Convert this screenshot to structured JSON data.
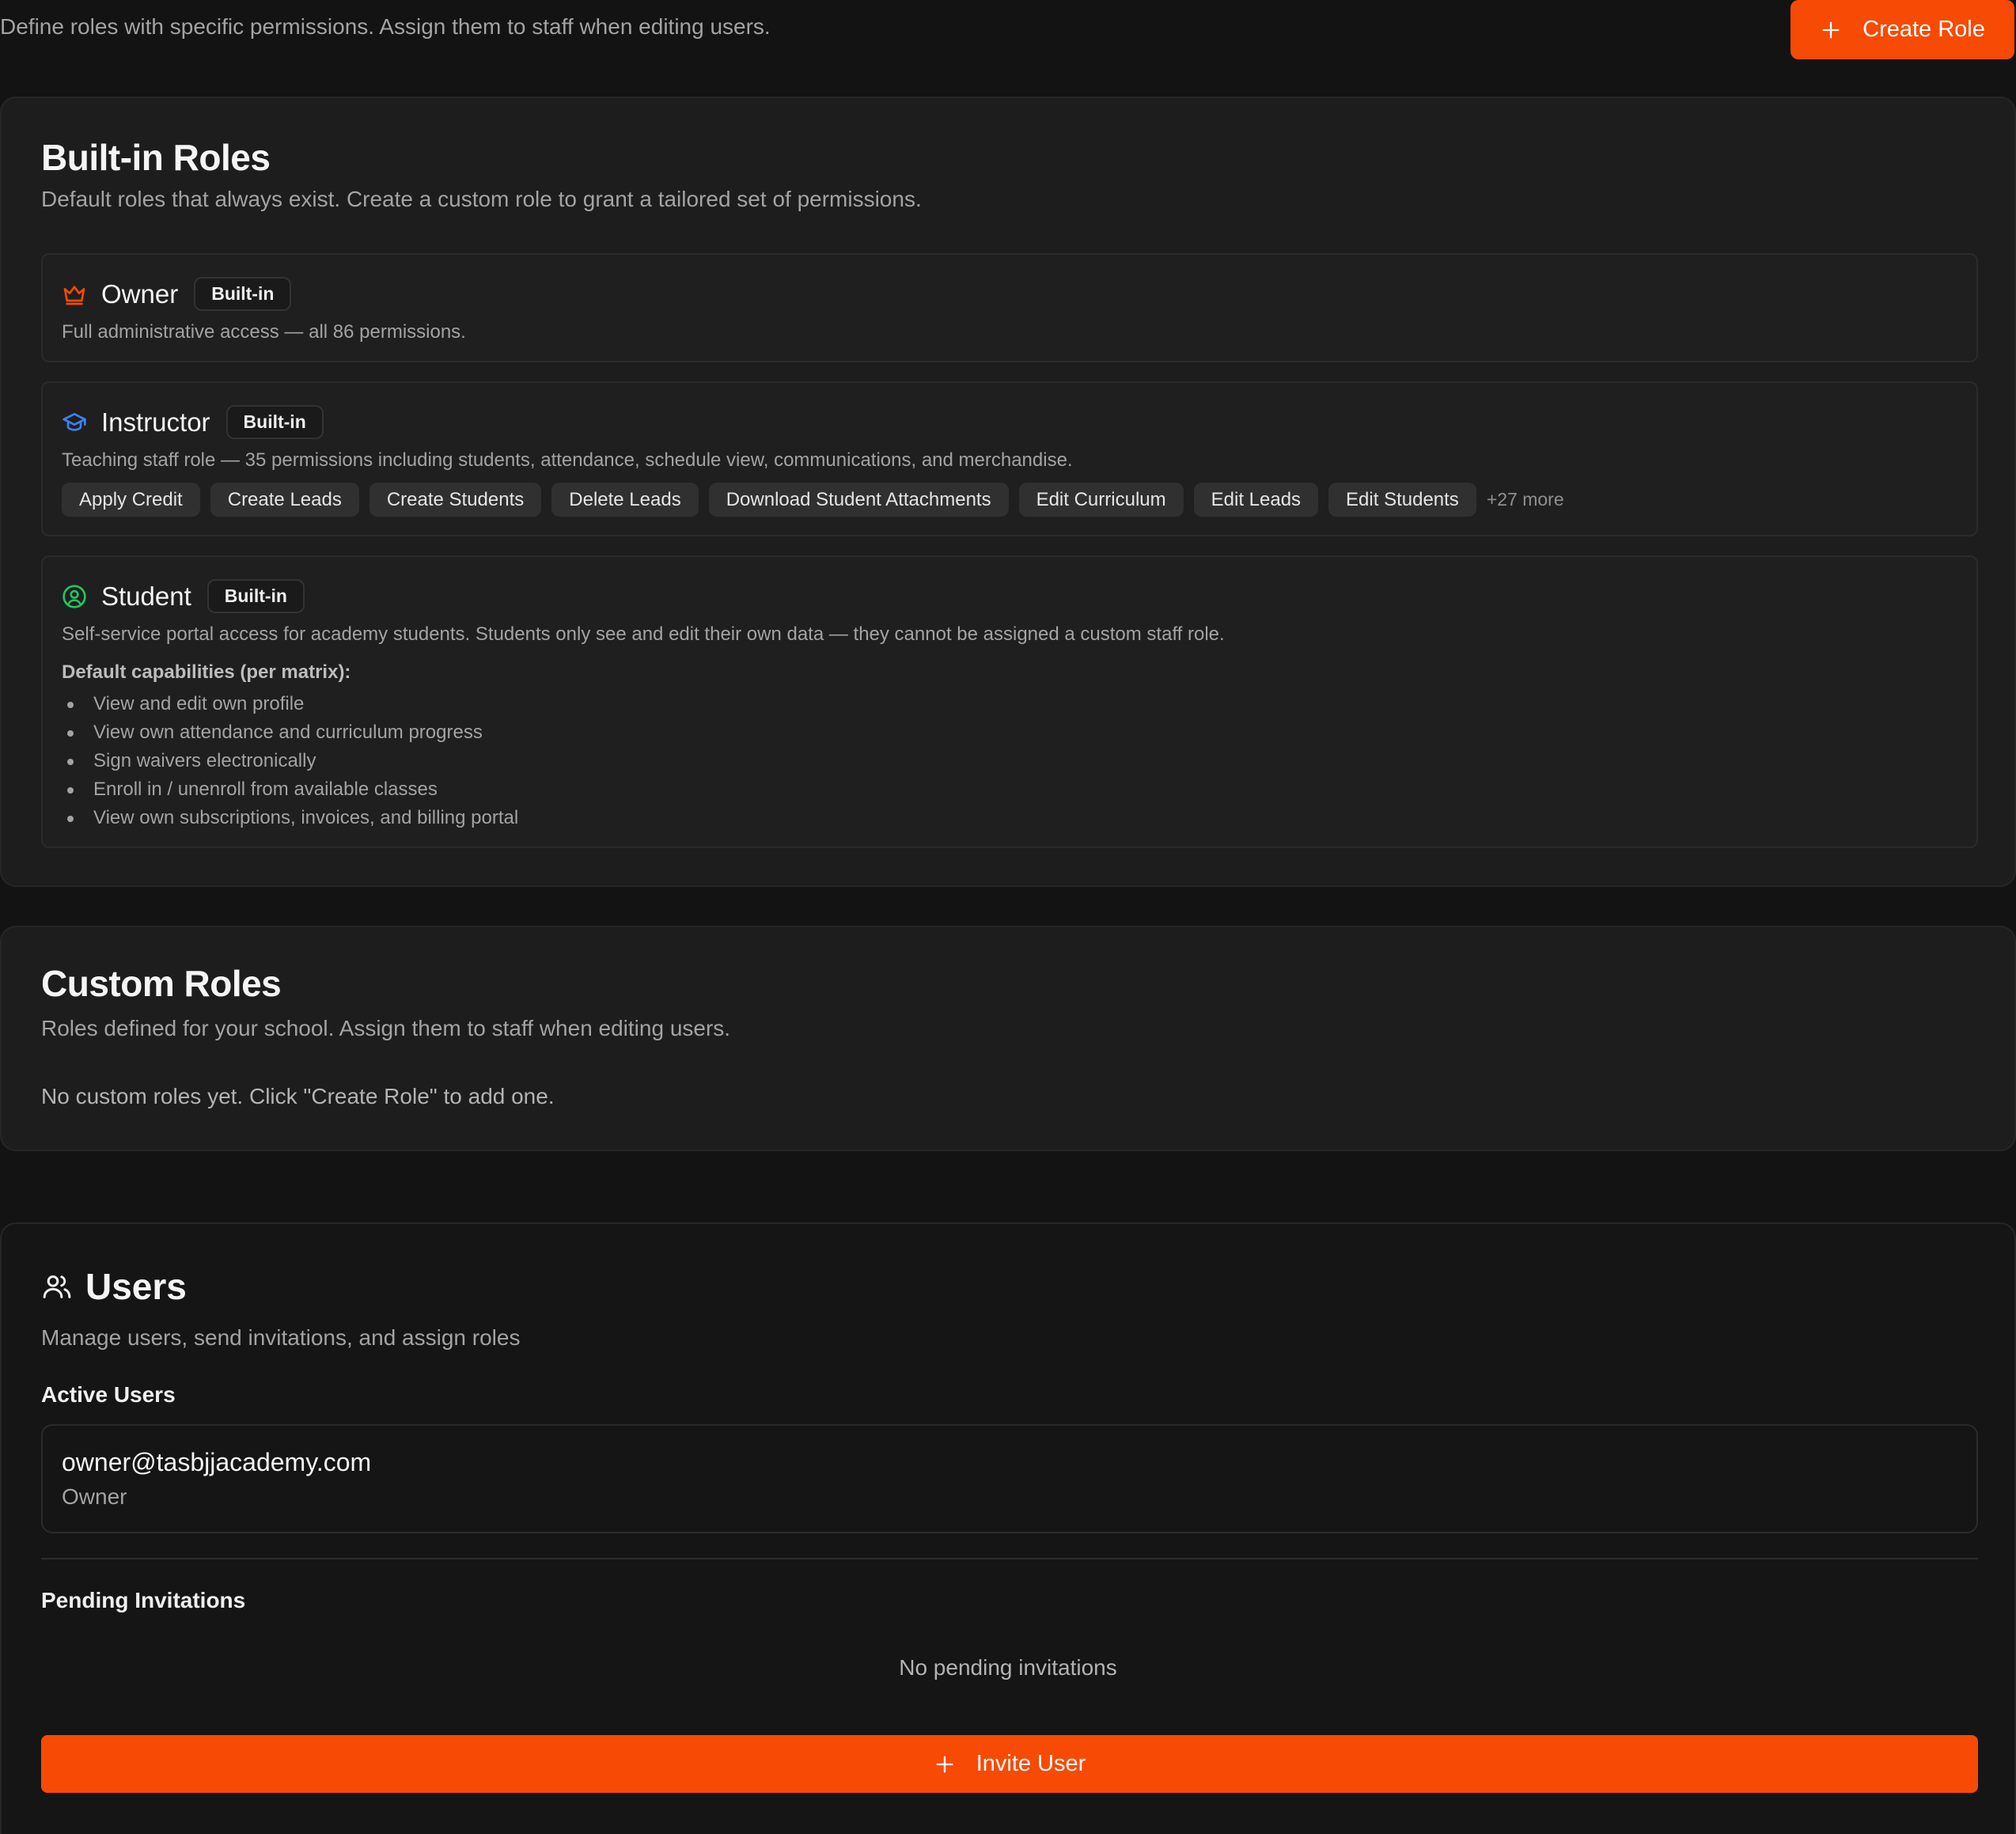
{
  "header": {
    "description": "Define roles with specific permissions. Assign them to staff when editing users.",
    "create_role_label": "Create Role"
  },
  "builtin_roles": {
    "title": "Built-in Roles",
    "subtitle": "Default roles that always exist. Create a custom role to grant a tailored set of permissions.",
    "badge_label": "Built-in",
    "owner": {
      "name": "Owner",
      "icon": "crown-icon",
      "icon_color": "#f74a04",
      "description": "Full administrative access — all 86 permissions."
    },
    "instructor": {
      "name": "Instructor",
      "icon": "graduation-cap-icon",
      "icon_color": "#3b82f6",
      "description": "Teaching staff role — 35 permissions including students, attendance, schedule view, communications, and merchandise.",
      "permissions": [
        "Apply Credit",
        "Create Leads",
        "Create Students",
        "Delete Leads",
        "Download Student Attachments",
        "Edit Curriculum",
        "Edit Leads",
        "Edit Students"
      ],
      "more_label": "+27 more"
    },
    "student": {
      "name": "Student",
      "icon": "user-circle-icon",
      "icon_color": "#22c55e",
      "description": "Self-service portal access for academy students. Students only see and edit their own data — they cannot be assigned a custom staff role.",
      "capabilities_title": "Default capabilities (per matrix):",
      "capabilities": [
        "View and edit own profile",
        "View own attendance and curriculum progress",
        "Sign waivers electronically",
        "Enroll in / unenroll from available classes",
        "View own subscriptions, invoices, and billing portal"
      ]
    }
  },
  "custom_roles": {
    "title": "Custom Roles",
    "subtitle": "Roles defined for your school. Assign them to staff when editing users.",
    "empty_text": "No custom roles yet. Click \"Create Role\" to add one."
  },
  "users": {
    "title": "Users",
    "icon": "users-icon",
    "subtitle": "Manage users, send invitations, and assign roles",
    "active_label": "Active Users",
    "active_users": [
      {
        "email": "owner@tasbjjacademy.com",
        "role": "Owner"
      }
    ],
    "pending_label": "Pending Invitations",
    "pending_empty": "No pending invitations",
    "invite_label": "Invite User"
  },
  "colors": {
    "accent": "#f74a04",
    "background": "#131313",
    "card": "#1d1d1d"
  }
}
